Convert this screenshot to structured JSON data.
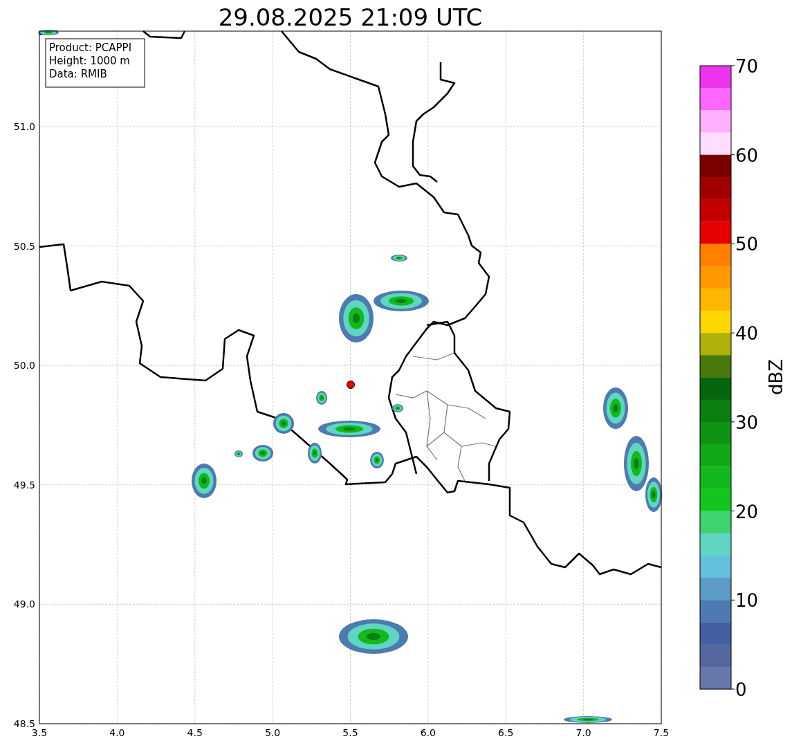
{
  "title": "29.08.2025 21:09 UTC",
  "info_box": [
    "Product: PCAPPI",
    "Height: 1000 m",
    "Data: RMIB"
  ],
  "x_axis": {
    "ticks": [
      "3.5",
      "4.0",
      "4.5",
      "5.0",
      "5.5",
      "6.0",
      "6.5",
      "7.0",
      "7.5"
    ]
  },
  "y_axis": {
    "ticks": [
      "51.0",
      "50.5",
      "50.0",
      "49.5",
      "49.0",
      "48.5"
    ]
  },
  "colorbar": {
    "label": "dBZ",
    "ticks": [
      "70",
      "60",
      "50",
      "40",
      "30",
      "20",
      "10",
      "0"
    ],
    "bins": [
      {
        "color": "#ee33ee"
      },
      {
        "color": "#ff66ff"
      },
      {
        "color": "#ffb0ff"
      },
      {
        "color": "#ffddff"
      },
      {
        "color": "#7a0000"
      },
      {
        "color": "#a00000"
      },
      {
        "color": "#c20000"
      },
      {
        "color": "#e60000"
      },
      {
        "color": "#ff7f00"
      },
      {
        "color": "#ff9900"
      },
      {
        "color": "#fdb700"
      },
      {
        "color": "#ffd700"
      },
      {
        "color": "#adb108"
      },
      {
        "color": "#47790b"
      },
      {
        "color": "#07660d"
      },
      {
        "color": "#0b7f10"
      },
      {
        "color": "#0e9312"
      },
      {
        "color": "#10a816"
      },
      {
        "color": "#12b81c"
      },
      {
        "color": "#13c61e"
      },
      {
        "color": "#3fd36f"
      },
      {
        "color": "#5fd6c2"
      },
      {
        "color": "#65c0dc"
      },
      {
        "color": "#5b9bc5"
      },
      {
        "color": "#4d7ab0"
      },
      {
        "color": "#4560a2"
      },
      {
        "color": "#56679f"
      },
      {
        "color": "#6677aa"
      }
    ]
  }
}
